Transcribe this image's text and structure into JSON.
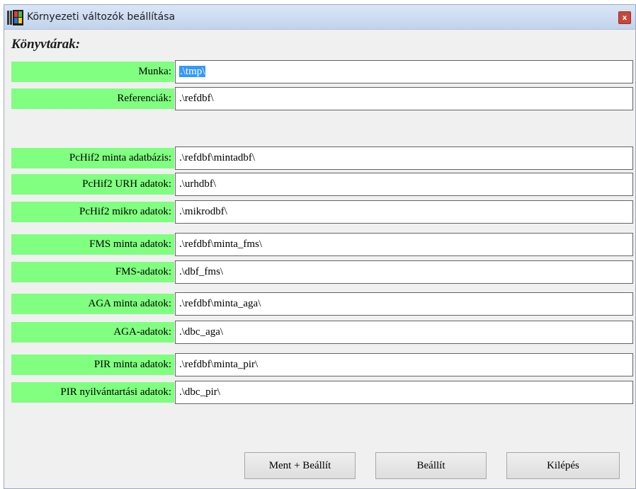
{
  "window": {
    "title": "Környezeti változók beállítása",
    "close_label": "x"
  },
  "heading": "Könyvtárak:",
  "fields": [
    {
      "label": "Munka:",
      "value": ".\\tmp\\",
      "selected": true
    },
    {
      "label": "Referenciák:",
      "value": ".\\refdbf\\"
    },
    {
      "label": "PcHif2 minta adatbázis:",
      "value": ".\\refdbf\\mintadbf\\"
    },
    {
      "label": "PcHif2 URH adatok:",
      "value": ".\\urhdbf\\"
    },
    {
      "label": "PcHif2 mikro adatok:",
      "value": ".\\mikrodbf\\"
    },
    {
      "label": "FMS minta adatok:",
      "value": ".\\refdbf\\minta_fms\\"
    },
    {
      "label": "FMS-adatok:",
      "value": ".\\dbf_fms\\"
    },
    {
      "label": "AGA minta adatok:",
      "value": ".\\refdbf\\minta_aga\\"
    },
    {
      "label": "AGA-adatok:",
      "value": ".\\dbc_aga\\"
    },
    {
      "label": "PIR minta adatok:",
      "value": ".\\refdbf\\minta_pir\\"
    },
    {
      "label": "PIR nyilvántartási adatok:",
      "value": ".\\dbc_pir\\"
    }
  ],
  "buttons": {
    "save_apply": "Ment + Beállít",
    "apply": "Beállít",
    "exit": "Kilépés"
  }
}
